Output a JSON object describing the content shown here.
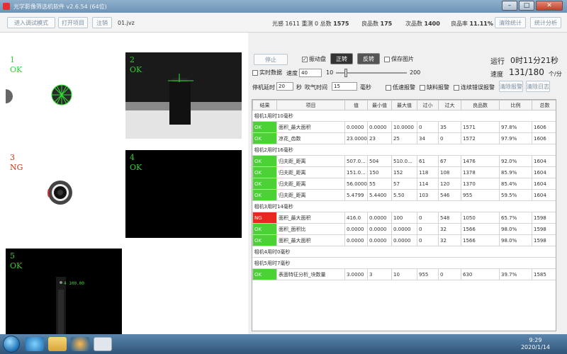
{
  "window": {
    "title": "光学影像筛选机软件 v2.6.54 (64位)",
    "minimize": "–",
    "maximize": "□",
    "close": "✕"
  },
  "toolbar": {
    "debug_mode_button": "进入调试模式",
    "open_project_button": "打开项目",
    "logout_button": "注销",
    "project_file": "01.jvz",
    "sensor_label": "光感",
    "sensor_value": "1611",
    "recheck_label": "重测",
    "recheck_value": "0",
    "total_label": "总数",
    "total_value": "1575",
    "good_label": "良品数",
    "good_value": "175",
    "defect_label": "次品数",
    "defect_value": "1400",
    "yield_label": "良品率",
    "yield_value": "11.11%",
    "clear_stats_button": "清除统计",
    "stats_analysis_button": "统计分析"
  },
  "cameras": [
    {
      "num": "1",
      "result": "OK",
      "status": "ok"
    },
    {
      "num": "2",
      "result": "OK",
      "status": "ok"
    },
    {
      "num": "3",
      "result": "NG",
      "status": "ng"
    },
    {
      "num": "4",
      "result": "OK",
      "status": "ok"
    },
    {
      "num": "5",
      "result": "OK",
      "status": "ok",
      "overlay_text": "4  100.00"
    }
  ],
  "controls": {
    "stop_button": "停止",
    "vibration_label": "振动盘",
    "forward_button": "正转",
    "reverse_button": "反转",
    "save_image_label": "保存图片",
    "running_label": "运行",
    "running_time": "0时11分21秒",
    "speed_label": "速度",
    "speed_value": "131/180",
    "speed_unit": "个/分",
    "realtime_label": "实时数据",
    "speed_setting_label": "速度",
    "speed_setting_value": "40",
    "slider_min": "10",
    "slider_max": "200",
    "slider_level": 0.12,
    "stop_delay_label": "停机延时",
    "stop_delay_value": "20",
    "seconds_label": "秒",
    "blow_time_label": "吹气时间",
    "blow_time_value": "15",
    "ms_label": "毫秒",
    "low_speed_alarm": "低速报警",
    "shortage_alarm": "缺料报警",
    "consecutive_error_alarm": "连续错误报警",
    "clear_alarm_button": "清除报警",
    "clear_log_button": "清除日志"
  },
  "table": {
    "headers": [
      "结果",
      "项目",
      "值",
      "最小值",
      "最大值",
      "过小",
      "过大",
      "良品数",
      "比例",
      "总数"
    ],
    "rows": [
      {
        "group": "相机1用时10毫秒"
      },
      {
        "result": "OK",
        "status": "ok",
        "cells": [
          "面积_最大面积",
          "0.0000",
          "0.0000",
          "10.0000",
          "0",
          "35",
          "1571",
          "97.8%",
          "1606"
        ]
      },
      {
        "result": "OK",
        "status": "ok",
        "cells": [
          "凉花_齿数",
          "23.0000",
          "23",
          "25",
          "34",
          "0",
          "1572",
          "97.9%",
          "1606"
        ]
      },
      {
        "group": "相机2用时16毫秒"
      },
      {
        "result": "OK",
        "status": "ok",
        "cells": [
          "归夫距_距离",
          "507.0...",
          "504",
          "510.0...",
          "61",
          "67",
          "1476",
          "92.0%",
          "1604"
        ]
      },
      {
        "result": "OK",
        "status": "ok",
        "cells": [
          "归夫距_距离",
          "151.0...",
          "150",
          "152",
          "118",
          "108",
          "1378",
          "85.9%",
          "1604"
        ]
      },
      {
        "result": "OK",
        "status": "ok",
        "cells": [
          "归夫距_距离",
          "56.0000",
          "55",
          "57",
          "114",
          "120",
          "1370",
          "85.4%",
          "1604"
        ]
      },
      {
        "result": "OK",
        "status": "ok",
        "cells": [
          "归夫距_距离",
          "5.4799",
          "5.4400",
          "5.50",
          "103",
          "546",
          "955",
          "59.5%",
          "1604"
        ]
      },
      {
        "group": "相机3用时14毫秒"
      },
      {
        "result": "NG",
        "status": "ng",
        "cells": [
          "面积_最大面积",
          "416.0",
          "0.0000",
          "100",
          "0",
          "548",
          "1050",
          "65.7%",
          "1598"
        ]
      },
      {
        "result": "OK",
        "status": "ok",
        "cells": [
          "面积_面积比",
          "0.0000",
          "0.0000",
          "0.0000",
          "0",
          "32",
          "1566",
          "98.0%",
          "1598"
        ]
      },
      {
        "result": "OK",
        "status": "ok",
        "cells": [
          "面积_最大面积",
          "0.0000",
          "0.0000",
          "0.0000",
          "0",
          "32",
          "1566",
          "98.0%",
          "1598"
        ]
      },
      {
        "group": "相机4用时0毫秒"
      },
      {
        "group": "相机5用时7毫秒"
      },
      {
        "result": "OK",
        "status": "ok",
        "cells": [
          "表面特征分析_块数量",
          "3.0000",
          "3",
          "10",
          "955",
          "0",
          "630",
          "39.7%",
          "1585"
        ]
      }
    ]
  },
  "taskbar": {
    "time": "9:29",
    "date": "2020/1/14"
  },
  "colors": {
    "ok": "#4cd137",
    "ng": "#e8281e",
    "camera_ok_text": "#33cc33",
    "camera_ng_text": "#cc3311"
  },
  "icons": [
    "windows-start-icon",
    "ie-icon",
    "folder-icon",
    "media-player-icon",
    "app-icon"
  ]
}
